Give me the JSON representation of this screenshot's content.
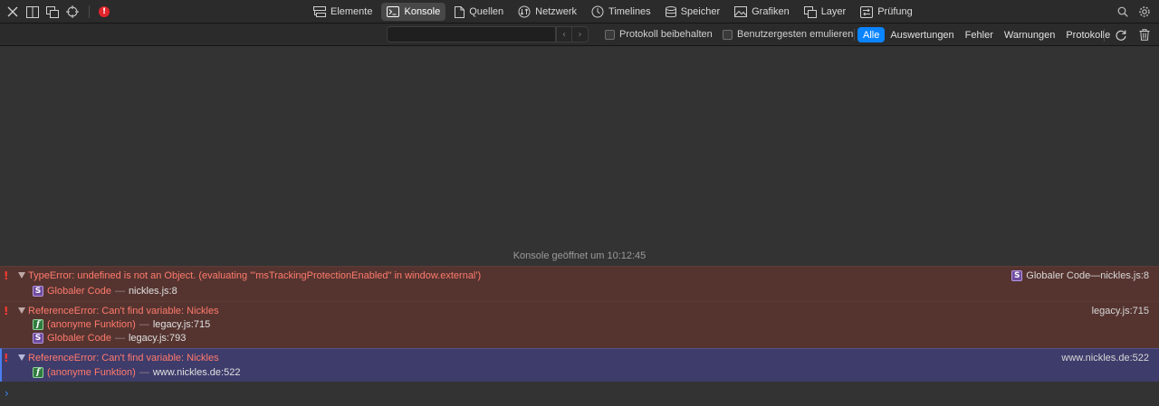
{
  "tabs": [
    {
      "label": "Elemente",
      "icon": "elements-icon"
    },
    {
      "label": "Konsole",
      "icon": "console-icon",
      "active": true
    },
    {
      "label": "Quellen",
      "icon": "sources-icon"
    },
    {
      "label": "Netzwerk",
      "icon": "network-icon"
    },
    {
      "label": "Timelines",
      "icon": "timelines-icon"
    },
    {
      "label": "Speicher",
      "icon": "storage-icon"
    },
    {
      "label": "Grafiken",
      "icon": "graphics-icon"
    },
    {
      "label": "Layer",
      "icon": "layers-icon"
    },
    {
      "label": "Prüfung",
      "icon": "audit-icon"
    }
  ],
  "toolbar": {
    "error_badge": "!"
  },
  "filter": {
    "search_value": "",
    "search_placeholder": "",
    "preserve_log": "Protokoll beibehalten",
    "emulate_gestures": "Benutzergesten emulieren",
    "levels": [
      "Alle",
      "Auswertungen",
      "Fehler",
      "Warnungen",
      "Protokolle"
    ],
    "active_level": "Alle"
  },
  "console": {
    "opened_text": "Konsole geöffnet um 10:12:45",
    "messages": [
      {
        "kind": "error",
        "text": "TypeError: undefined is not an Object. (evaluating '\"msTrackingProtectionEnabled\" in window.external')",
        "source_badge": "S",
        "source_label": "Globaler Code",
        "source_file": "nickles.js:8",
        "frames": [
          {
            "badge": "S",
            "name": "Globaler Code",
            "file": "nickles.js:8"
          }
        ]
      },
      {
        "kind": "error",
        "text": "ReferenceError: Can't find variable: Nickles",
        "source_file": "legacy.js:715",
        "frames": [
          {
            "badge": "f",
            "name": "(anonyme Funktion)",
            "file": "legacy.js:715"
          },
          {
            "badge": "S",
            "name": "Globaler Code",
            "file": "legacy.js:793"
          }
        ]
      },
      {
        "kind": "error-selected",
        "text": "ReferenceError: Can't find variable: Nickles",
        "source_file": "www.nickles.de:522",
        "frames": [
          {
            "badge": "f",
            "name": "(anonyme Funktion)",
            "file": "www.nickles.de:522"
          }
        ]
      }
    ],
    "separator": "—"
  },
  "colors": {
    "accent": "#0a84ff",
    "error_row": "#553430",
    "selected_row": "#3e3c6b",
    "error_text": "#ff7a6c",
    "error_icon": "#ff3b30"
  }
}
